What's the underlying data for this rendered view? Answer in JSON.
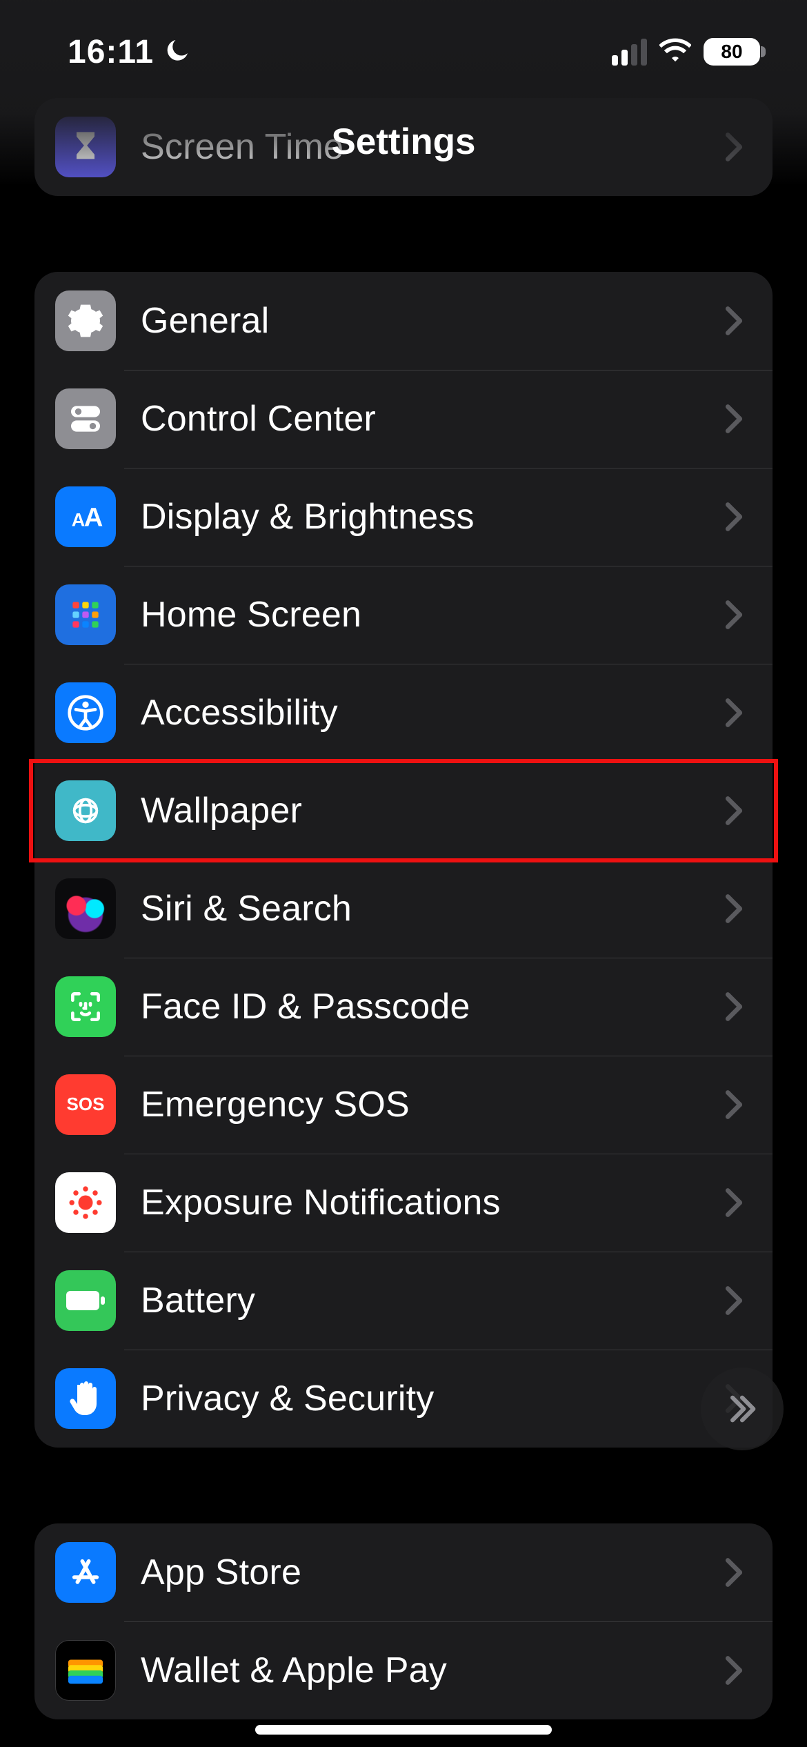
{
  "status": {
    "time": "16:11",
    "battery": "80"
  },
  "nav": {
    "title": "Settings"
  },
  "rows": {
    "screen_time": "Screen Time",
    "general": "General",
    "control": "Control Center",
    "display": "Display & Brightness",
    "home": "Home Screen",
    "access": "Accessibility",
    "wallpaper": "Wallpaper",
    "siri": "Siri & Search",
    "faceid": "Face ID & Passcode",
    "sos": "Emergency SOS",
    "exposure": "Exposure Notifications",
    "battery": "Battery",
    "privacy": "Privacy & Security",
    "appstore": "App Store",
    "wallet": "Wallet & Apple Pay"
  },
  "highlight": {
    "row": "wallpaper"
  }
}
